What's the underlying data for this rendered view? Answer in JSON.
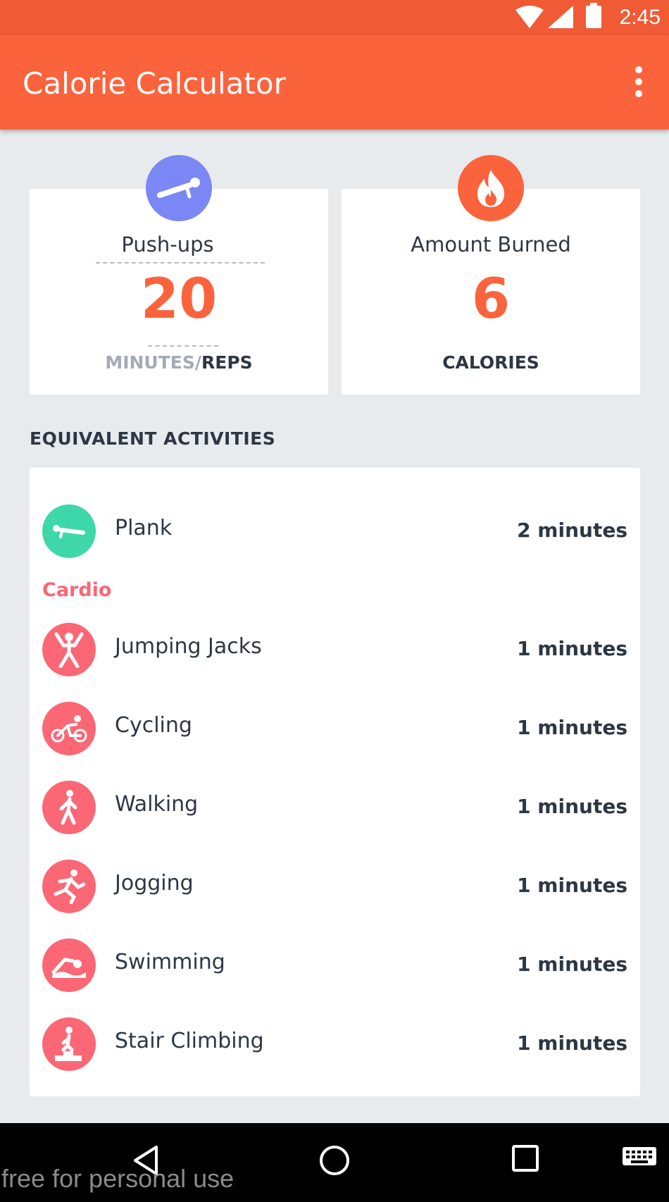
{
  "status_bar": {
    "time": "2:45"
  },
  "app_bar": {
    "title": "Calorie Calculator",
    "menu_icon": "overflow-menu-icon"
  },
  "colors": {
    "accent": "#fb633c",
    "status_bar": "#f05a35",
    "pink": "#fb6775",
    "green": "#3ed7a9",
    "purple": "#7b87f5"
  },
  "exercise_card": {
    "icon": "pushup-icon",
    "label": "Push-ups",
    "value": "20",
    "unit_muted": "MINUTES/",
    "unit_active": "REPS"
  },
  "burned_card": {
    "icon": "fire-icon",
    "label": "Amount Burned",
    "value": "6",
    "unit": "CALORIES"
  },
  "section_title": "EQUIVALENT ACTIVITIES",
  "activities": {
    "plank": {
      "name": "Plank",
      "duration": "2 minutes",
      "icon": "plank-icon"
    },
    "category": "Cardio",
    "cardio": [
      {
        "name": "Jumping Jacks",
        "duration": "1 minutes",
        "icon": "jumping-jacks-icon"
      },
      {
        "name": "Cycling",
        "duration": "1 minutes",
        "icon": "cycling-icon"
      },
      {
        "name": "Walking",
        "duration": "1 minutes",
        "icon": "walking-icon"
      },
      {
        "name": "Jogging",
        "duration": "1 minutes",
        "icon": "jogging-icon"
      },
      {
        "name": "Swimming",
        "duration": "1 minutes",
        "icon": "swimming-icon"
      },
      {
        "name": "Stair Climbing",
        "duration": "1 minutes",
        "icon": "stair-climbing-icon"
      }
    ]
  },
  "navigation_bar": {
    "buttons": [
      "back-icon",
      "home-icon",
      "recents-icon",
      "keyboard-icon"
    ]
  },
  "watermark": "free for personal use"
}
